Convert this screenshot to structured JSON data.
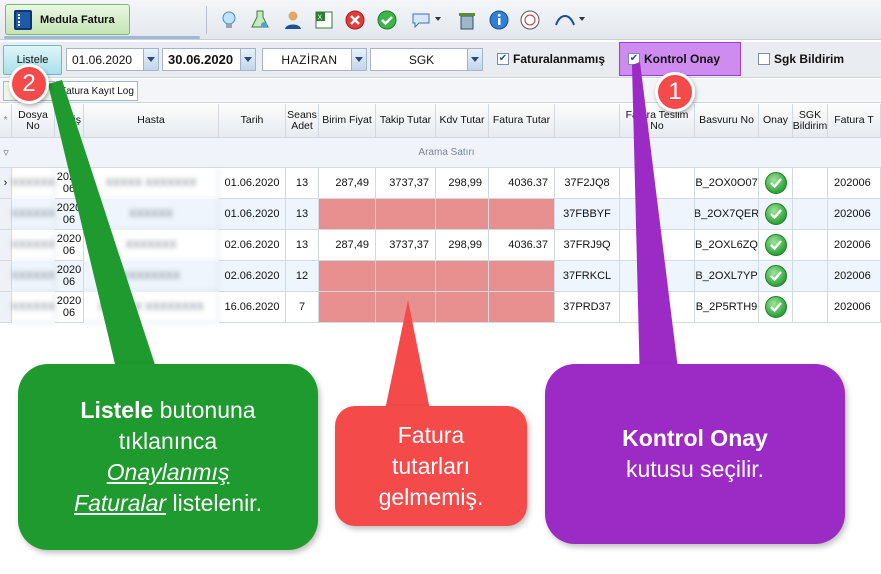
{
  "app_tab": {
    "label": "Medula Fatura"
  },
  "toolbar": {
    "icons": [
      "lightbulb-icon",
      "flask-icon",
      "user-icon",
      "excel-icon",
      "cancel-icon",
      "approve-icon",
      "message-icon",
      "delete-icon",
      "info-icon",
      "health-ministry-icon",
      "sgk-icon"
    ],
    "sgk_label": "SGK"
  },
  "filter": {
    "listele_label": "Listele",
    "start_date": "01.06.2020",
    "end_date": "30.06.2020",
    "month": "HAZİRAN",
    "institution": "SGK",
    "faturalanmamis_label": "Faturalanmamış",
    "faturalanmamis_checked": true,
    "kontrol_onay_label": "Kontrol Onay",
    "kontrol_onay_checked": true,
    "sgk_bildirim_label": "Sgk Bildirim",
    "sgk_bildirim_checked": false,
    "kontrol_onay_highlight": "#cf8cf0"
  },
  "subtabs": {
    "first": "",
    "log_label": "Fatura Kayıt Log"
  },
  "grid": {
    "headers": [
      "Dosya No",
      "Geliş",
      "Hasta",
      "Tarih",
      "Seans Adet",
      "Birim Fiyat",
      "Takip Tutar",
      "Kdv Tutar",
      "Fatura Tutar",
      "",
      "Fatura Teslim No",
      "Basvuru No",
      "Onay",
      "SGK Bildirim",
      "Fatura T"
    ],
    "search_row_label": "Arama Satırı",
    "rows": [
      {
        "dosya": "XXXXXX",
        "gelis": [
          "2020",
          "06"
        ],
        "hasta": "XXXXX XXXXXXX",
        "tarih": "01.06.2020",
        "seans": "13",
        "birim": "287,49",
        "takip": "3737,37",
        "kdv": "298,99",
        "fatura": "4036.37",
        "takip_no": "37F2JQ8",
        "teslim": "",
        "basvuru": "B_2OX0O07",
        "onay": true,
        "bildirim": "",
        "fatura_t": "202006",
        "missing": false
      },
      {
        "dosya": "XXXXXX",
        "gelis": [
          "2020",
          "06"
        ],
        "hasta": "XXXXXX",
        "tarih": "01.06.2020",
        "seans": "13",
        "birim": "",
        "takip": "",
        "kdv": "",
        "fatura": "",
        "takip_no": "37FBBYF",
        "teslim": "",
        "basvuru": "B_2OX7QER",
        "onay": true,
        "bildirim": "",
        "fatura_t": "202006",
        "missing": true
      },
      {
        "dosya": "XXXXXX",
        "gelis": [
          "2020",
          "06"
        ],
        "hasta": "XXXXXXX",
        "tarih": "02.06.2020",
        "seans": "13",
        "birim": "287,49",
        "takip": "3737,37",
        "kdv": "298,99",
        "fatura": "4036.37",
        "takip_no": "37FRJ9Q",
        "teslim": "",
        "basvuru": "B_2OXL6ZQ",
        "onay": true,
        "bildirim": "",
        "fatura_t": "202006",
        "missing": false
      },
      {
        "dosya": "XXXXXX",
        "gelis": [
          "2020",
          "06"
        ],
        "hasta": "XXXXXXXX",
        "tarih": "02.06.2020",
        "seans": "12",
        "birim": "",
        "takip": "",
        "kdv": "",
        "fatura": "",
        "takip_no": "37FRKCL",
        "teslim": "",
        "basvuru": "B_2OXL7YP",
        "onay": true,
        "bildirim": "",
        "fatura_t": "202006",
        "missing": true
      },
      {
        "dosya": "XXXXXX",
        "gelis": [
          "2020",
          "06"
        ],
        "hasta": "XXXXXX XXXXXXXX",
        "tarih": "16.06.2020",
        "seans": "7",
        "birim": "",
        "takip": "",
        "kdv": "",
        "fatura": "",
        "takip_no": "37PRD37",
        "teslim": "",
        "basvuru": "B_2P5RTH9",
        "onay": true,
        "bildirim": "",
        "fatura_t": "202006",
        "missing": true
      }
    ],
    "missing_color": "#e89090"
  },
  "callouts": {
    "green": {
      "bold": "Listele",
      "line1_rest": " butonuna",
      "line2": "tıklanınca",
      "link1": "Onaylanmış ",
      "link2": "Faturalar",
      "line4_rest": " listelenir.",
      "color": "#1f9a2e"
    },
    "red": {
      "text1": "Fatura",
      "text2": "tutarları",
      "text3": "gelmemiş.",
      "color": "#f44a4a"
    },
    "purple": {
      "bold": "Kontrol Onay",
      "text": "kutusu seçilir.",
      "color": "#9b2bc4"
    },
    "badge1": {
      "label": "1",
      "color": "#f44a4a"
    },
    "badge2": {
      "label": "2",
      "color": "#f44a4a"
    }
  }
}
